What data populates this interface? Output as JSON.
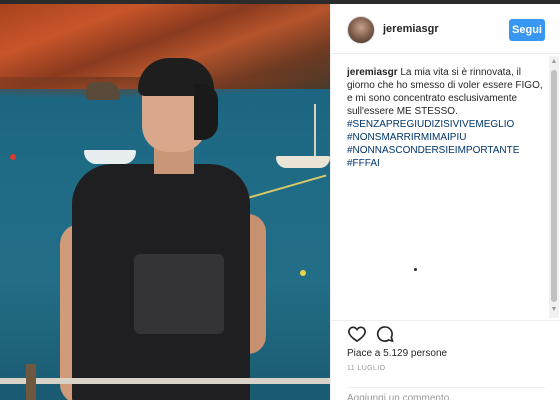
{
  "post": {
    "username": "jeremiasgr",
    "follow_label": "Segui",
    "caption": {
      "user": "jeremiasgr",
      "text": "La mia vita si è rinnovata, il giorno che ho smesso di voler essere FIGO, e mi sono concentrato esclusivamente sull'essere ME STESSO.",
      "hashtags": [
        "#SENZAPREGIUDIZISIVIVEMEGLIO",
        "#NONSMARRIRMIMAIPIU",
        "#NONNASCONDERSIEIMPORTANTE #FFFAI"
      ]
    },
    "likes_text": "Piace a 5.129 persone",
    "date": "11 LUGLIO",
    "comment_placeholder": "Aggiungi un commento...",
    "icons": {
      "avatar": "profile-avatar",
      "like": "heart-icon",
      "comment": "speech-bubble-icon"
    },
    "colors": {
      "follow_button": "#3897f0",
      "hashtag": "#003569"
    }
  }
}
